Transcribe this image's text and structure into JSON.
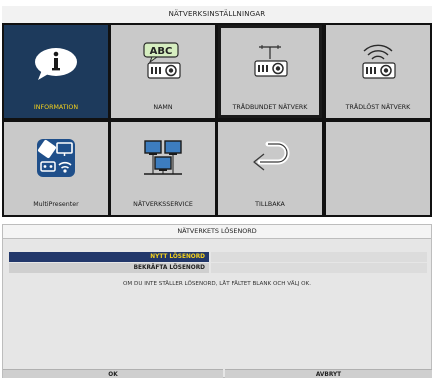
{
  "menu": {
    "title": "NÄTVERKSINSTÄLLNINGAR",
    "tiles": [
      {
        "label": "INFORMATION",
        "icon": "info-icon",
        "selected": true
      },
      {
        "label": "NAMN",
        "icon": "abc-projector-icon",
        "badge": "ABC"
      },
      {
        "label": "TRÅDBUNDET NÄTVERK",
        "icon": "wired-projector-icon",
        "focused": true
      },
      {
        "label": "TRÅDLÖST NÄTVERK",
        "icon": "wireless-projector-icon"
      },
      {
        "label": "MultiPresenter",
        "icon": "multipresenter-icon"
      },
      {
        "label": "NÄTVERKSSERVICE",
        "icon": "network-service-icon"
      },
      {
        "label": "TILLBAKA",
        "icon": "back-arrow-icon"
      },
      {
        "label": "",
        "icon": ""
      }
    ]
  },
  "dialog": {
    "title": "NÄTVERKETS LÖSENORD",
    "new_password_label": "NYTT LÖSENORD",
    "confirm_password_label": "BEKRÄFTA LÖSENORD",
    "hint": "OM DU INTE STÄLLER LÖSENORD, LÅT FÄLTET BLANK OCH VÄLJ OK.",
    "ok_label": "OK",
    "cancel_label": "AVBRYT"
  },
  "colors": {
    "selected_tile": "#1d3a5c",
    "selected_text": "#f5d21c",
    "tile": "#c9c9c9"
  }
}
